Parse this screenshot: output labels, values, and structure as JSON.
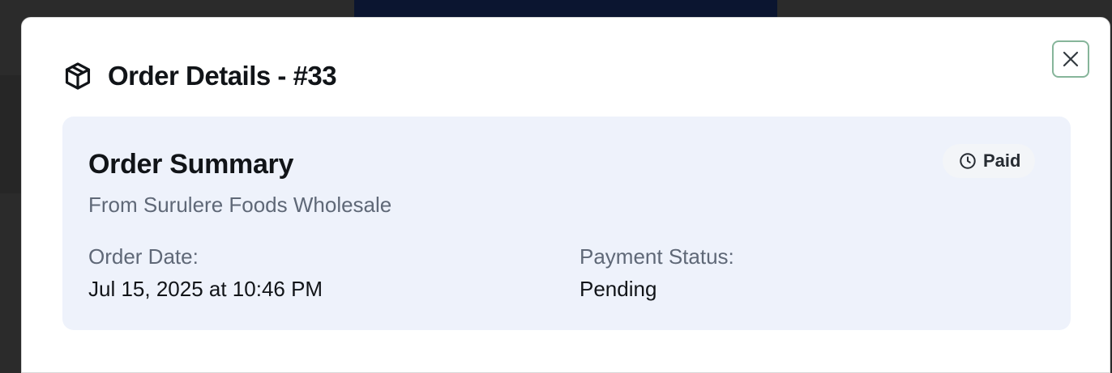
{
  "modal": {
    "title": "Order Details - #33",
    "close_icon": "close-icon",
    "header_icon": "package-icon"
  },
  "summary": {
    "title": "Order Summary",
    "subtitle": "From Surulere Foods Wholesale",
    "badge": {
      "icon": "clock-icon",
      "label": "Paid"
    },
    "order_date_label": "Order Date:",
    "order_date_value": "Jul 15, 2025 at 10:46 PM",
    "payment_status_label": "Payment Status:",
    "payment_status_value": "Pending"
  },
  "colors": {
    "card_bg": "#eef2fb",
    "close_border": "#86b59a",
    "backdrop": "#2b2b2b",
    "top_strip": "#0b1530"
  }
}
